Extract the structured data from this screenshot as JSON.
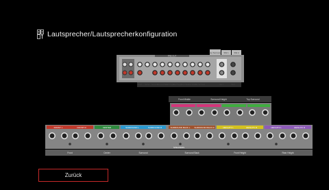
{
  "header": {
    "title": "Lautsprecher/Lautsprecherkonfiguration",
    "icon": "speaker-config-icon"
  },
  "rear_panel": {
    "top_labels": [
      "PRE OUT"
    ],
    "tab_labels": [
      "Top Surround",
      "SW 1",
      "SW 2"
    ],
    "bottom_labels": [
      "Front",
      "Center",
      "Surround",
      "Surround Back",
      "Front Height",
      "Rear Height",
      "Front Wide",
      "Top Middle",
      "Top Surround",
      "SW 1",
      "SW 2"
    ]
  },
  "speaker_panel": {
    "upper_group_labels": [
      "Front Middle",
      "Surround Height",
      "Top Surround"
    ],
    "terminal_labels": [
      "FRONT L",
      "FRONT R",
      "CENTER",
      "SURROUND L",
      "SURROUND R",
      "SURROUND BACK L",
      "SURROUND BACK R",
      "HEIGHT1 L",
      "HEIGHT1 R",
      "HEIGHT2 L",
      "HEIGHT2 R"
    ],
    "section_label": "SPEAKERS",
    "bottom_labels": [
      "Front",
      "Center",
      "Surround",
      "Surround Back",
      "Front Height",
      "Rear Height"
    ]
  },
  "actions": {
    "back_label": "Zurück"
  },
  "colors": {
    "accent_red": "#c72a2a",
    "front": "#c0392b",
    "center": "#2e8b3e",
    "surround": "#2a9ad1",
    "surround_back": "#a0522d",
    "height1": "#d4c21f",
    "height2": "#8e5bb8",
    "top_pink": "#d4357a",
    "top_green": "#3fae3f"
  }
}
